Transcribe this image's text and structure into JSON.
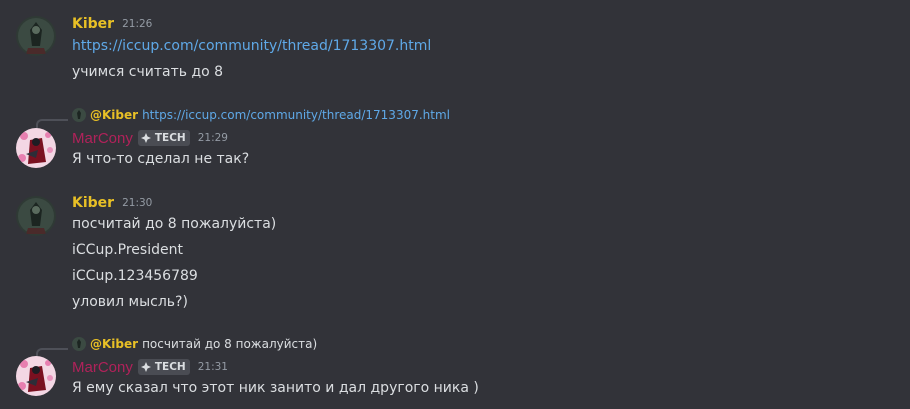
{
  "messages": [
    {
      "author": "Kiber",
      "time": "21:26",
      "lines": [
        "https://iccup.com/community/thread/1713307.html",
        "учимся считать до 8"
      ]
    },
    {
      "author": "MarCony",
      "tag": "TECH",
      "time": "21:29",
      "reply_to": {
        "mention": "@Kiber",
        "text": "https://iccup.com/community/thread/1713307.html"
      },
      "lines": [
        "Я что-то сделал не так?"
      ]
    },
    {
      "author": "Kiber",
      "time": "21:30",
      "lines": [
        "посчитай до 8 пожалуйста)",
        "iCCup.President",
        "iCCup.123456789",
        "уловил мысль?)"
      ]
    },
    {
      "author": "MarCony",
      "tag": "TECH",
      "time": "21:31",
      "reply_to": {
        "mention": "@Kiber",
        "text": "посчитай до 8 пожалуйста)"
      },
      "lines": [
        "Я ему сказал что этот ник занито и дал другого ника )"
      ]
    }
  ],
  "colors": {
    "background": "#323339",
    "kiber_name": "#e8c026",
    "marcony_name": "#b0225a",
    "link": "#5fa9e8",
    "timestamp": "#949ba4"
  }
}
